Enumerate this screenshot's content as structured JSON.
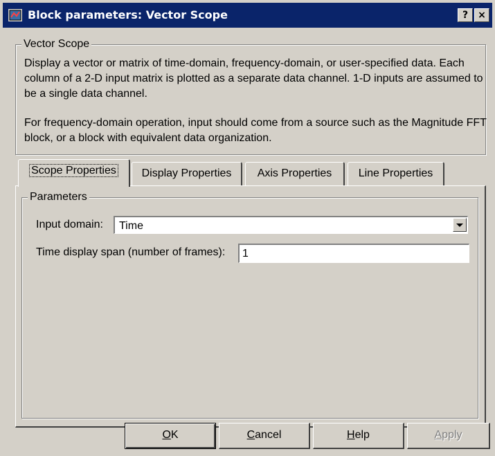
{
  "window": {
    "title": "Block parameters: Vector Scope",
    "help_button": "?",
    "close_button": "×"
  },
  "description": {
    "group_label": "Vector Scope",
    "paragraph1": "Display a vector or matrix of time-domain, frequency-domain, or user-specified data. Each column of a 2-D input matrix is plotted as a separate data channel.  1-D inputs are assumed to be a single data channel.",
    "paragraph2": "For frequency-domain operation, input should come from a source such as the Magnitude FFT block, or a block with equivalent data organization."
  },
  "tabs": [
    {
      "label": "Scope Properties",
      "active": true
    },
    {
      "label": "Display Properties",
      "active": false
    },
    {
      "label": "Axis Properties",
      "active": false
    },
    {
      "label": "Line Properties",
      "active": false
    }
  ],
  "parameters": {
    "group_label": "Parameters",
    "input_domain": {
      "label": "Input domain:",
      "value": "Time"
    },
    "time_span": {
      "label": "Time display span (number of frames):",
      "value": "1"
    }
  },
  "buttons": {
    "ok": {
      "mnemonic": "O",
      "rest": "K"
    },
    "cancel": {
      "mnemonic": "C",
      "rest": "ancel"
    },
    "help": {
      "mnemonic": "H",
      "rest": "elp"
    },
    "apply": {
      "mnemonic": "A",
      "rest": "pply",
      "enabled": false
    }
  },
  "colors": {
    "titlebar": "#0a246a",
    "dialog_bg": "#d4d0c8"
  }
}
